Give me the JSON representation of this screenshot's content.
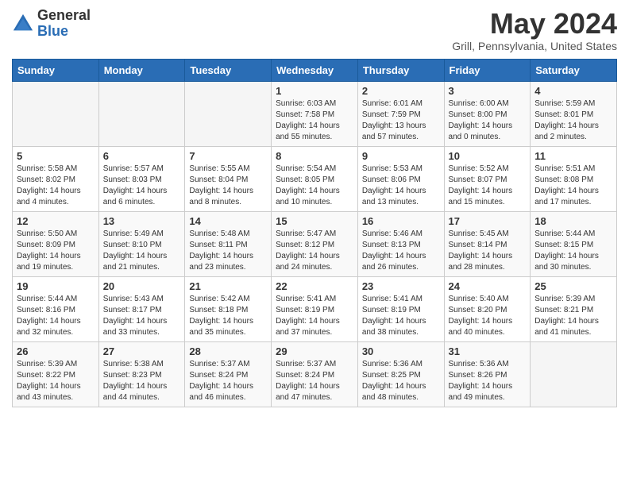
{
  "logo": {
    "general": "General",
    "blue": "Blue"
  },
  "title": "May 2024",
  "location": "Grill, Pennsylvania, United States",
  "days_of_week": [
    "Sunday",
    "Monday",
    "Tuesday",
    "Wednesday",
    "Thursday",
    "Friday",
    "Saturday"
  ],
  "weeks": [
    [
      {
        "day": "",
        "info": ""
      },
      {
        "day": "",
        "info": ""
      },
      {
        "day": "",
        "info": ""
      },
      {
        "day": "1",
        "info": "Sunrise: 6:03 AM\nSunset: 7:58 PM\nDaylight: 14 hours\nand 55 minutes."
      },
      {
        "day": "2",
        "info": "Sunrise: 6:01 AM\nSunset: 7:59 PM\nDaylight: 13 hours\nand 57 minutes."
      },
      {
        "day": "3",
        "info": "Sunrise: 6:00 AM\nSunset: 8:00 PM\nDaylight: 14 hours\nand 0 minutes."
      },
      {
        "day": "4",
        "info": "Sunrise: 5:59 AM\nSunset: 8:01 PM\nDaylight: 14 hours\nand 2 minutes."
      }
    ],
    [
      {
        "day": "5",
        "info": "Sunrise: 5:58 AM\nSunset: 8:02 PM\nDaylight: 14 hours\nand 4 minutes."
      },
      {
        "day": "6",
        "info": "Sunrise: 5:57 AM\nSunset: 8:03 PM\nDaylight: 14 hours\nand 6 minutes."
      },
      {
        "day": "7",
        "info": "Sunrise: 5:55 AM\nSunset: 8:04 PM\nDaylight: 14 hours\nand 8 minutes."
      },
      {
        "day": "8",
        "info": "Sunrise: 5:54 AM\nSunset: 8:05 PM\nDaylight: 14 hours\nand 10 minutes."
      },
      {
        "day": "9",
        "info": "Sunrise: 5:53 AM\nSunset: 8:06 PM\nDaylight: 14 hours\nand 13 minutes."
      },
      {
        "day": "10",
        "info": "Sunrise: 5:52 AM\nSunset: 8:07 PM\nDaylight: 14 hours\nand 15 minutes."
      },
      {
        "day": "11",
        "info": "Sunrise: 5:51 AM\nSunset: 8:08 PM\nDaylight: 14 hours\nand 17 minutes."
      }
    ],
    [
      {
        "day": "12",
        "info": "Sunrise: 5:50 AM\nSunset: 8:09 PM\nDaylight: 14 hours\nand 19 minutes."
      },
      {
        "day": "13",
        "info": "Sunrise: 5:49 AM\nSunset: 8:10 PM\nDaylight: 14 hours\nand 21 minutes."
      },
      {
        "day": "14",
        "info": "Sunrise: 5:48 AM\nSunset: 8:11 PM\nDaylight: 14 hours\nand 23 minutes."
      },
      {
        "day": "15",
        "info": "Sunrise: 5:47 AM\nSunset: 8:12 PM\nDaylight: 14 hours\nand 24 minutes."
      },
      {
        "day": "16",
        "info": "Sunrise: 5:46 AM\nSunset: 8:13 PM\nDaylight: 14 hours\nand 26 minutes."
      },
      {
        "day": "17",
        "info": "Sunrise: 5:45 AM\nSunset: 8:14 PM\nDaylight: 14 hours\nand 28 minutes."
      },
      {
        "day": "18",
        "info": "Sunrise: 5:44 AM\nSunset: 8:15 PM\nDaylight: 14 hours\nand 30 minutes."
      }
    ],
    [
      {
        "day": "19",
        "info": "Sunrise: 5:44 AM\nSunset: 8:16 PM\nDaylight: 14 hours\nand 32 minutes."
      },
      {
        "day": "20",
        "info": "Sunrise: 5:43 AM\nSunset: 8:17 PM\nDaylight: 14 hours\nand 33 minutes."
      },
      {
        "day": "21",
        "info": "Sunrise: 5:42 AM\nSunset: 8:18 PM\nDaylight: 14 hours\nand 35 minutes."
      },
      {
        "day": "22",
        "info": "Sunrise: 5:41 AM\nSunset: 8:19 PM\nDaylight: 14 hours\nand 37 minutes."
      },
      {
        "day": "23",
        "info": "Sunrise: 5:41 AM\nSunset: 8:19 PM\nDaylight: 14 hours\nand 38 minutes."
      },
      {
        "day": "24",
        "info": "Sunrise: 5:40 AM\nSunset: 8:20 PM\nDaylight: 14 hours\nand 40 minutes."
      },
      {
        "day": "25",
        "info": "Sunrise: 5:39 AM\nSunset: 8:21 PM\nDaylight: 14 hours\nand 41 minutes."
      }
    ],
    [
      {
        "day": "26",
        "info": "Sunrise: 5:39 AM\nSunset: 8:22 PM\nDaylight: 14 hours\nand 43 minutes."
      },
      {
        "day": "27",
        "info": "Sunrise: 5:38 AM\nSunset: 8:23 PM\nDaylight: 14 hours\nand 44 minutes."
      },
      {
        "day": "28",
        "info": "Sunrise: 5:37 AM\nSunset: 8:24 PM\nDaylight: 14 hours\nand 46 minutes."
      },
      {
        "day": "29",
        "info": "Sunrise: 5:37 AM\nSunset: 8:24 PM\nDaylight: 14 hours\nand 47 minutes."
      },
      {
        "day": "30",
        "info": "Sunrise: 5:36 AM\nSunset: 8:25 PM\nDaylight: 14 hours\nand 48 minutes."
      },
      {
        "day": "31",
        "info": "Sunrise: 5:36 AM\nSunset: 8:26 PM\nDaylight: 14 hours\nand 49 minutes."
      },
      {
        "day": "",
        "info": ""
      }
    ]
  ],
  "colors": {
    "header_bg": "#2a6db5",
    "header_text": "#ffffff",
    "border": "#cccccc"
  }
}
